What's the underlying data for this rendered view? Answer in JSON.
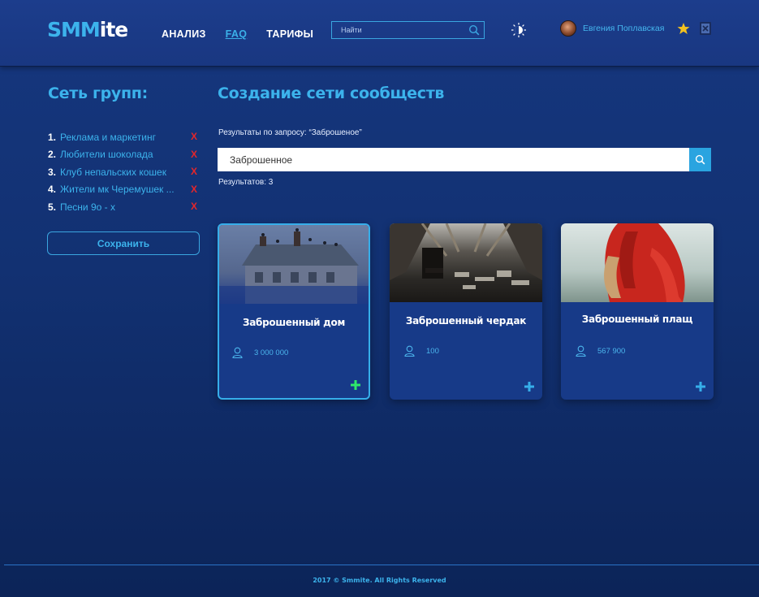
{
  "header": {
    "logo_main": "SMM",
    "logo_accent": "ite",
    "nav": [
      {
        "label": "АНАЛИЗ"
      },
      {
        "label": "FAQ",
        "active": true
      },
      {
        "label": "ТАРИФЫ"
      }
    ],
    "search_placeholder": "Найти",
    "user_name": "Евгения Поплавская"
  },
  "sidebar": {
    "title": "Сеть групп:",
    "groups": [
      {
        "num": "1.",
        "name": "Реклама и маркетинг"
      },
      {
        "num": "2.",
        "name": "Любители шоколада"
      },
      {
        "num": "3.",
        "name": "Клуб непальских кошек"
      },
      {
        "num": "4.",
        "name": "Жители мк Черемушек ..."
      },
      {
        "num": "5.",
        "name": "Песни 9о - х"
      }
    ],
    "remove_label": "X",
    "save_label": "Сохранить"
  },
  "main": {
    "title": "Создание сети сообществ",
    "query_label": "Результаты по запросу: “Заброшеное”",
    "search_value": "Заброшенное",
    "results_label": "Результатов: 3",
    "cards": [
      {
        "title": "Заброшенный дом",
        "members": "3 000 000",
        "selected": true,
        "image": "abandoned-house"
      },
      {
        "title": "Заброшенный чердак",
        "members": "100",
        "selected": false,
        "image": "abandoned-attic"
      },
      {
        "title": "Заброшенный плащ",
        "members": "567 900",
        "selected": false,
        "image": "red-cloak"
      }
    ]
  },
  "footer": {
    "copyright": "2017 © Smmite. All Rights Reserved"
  },
  "colors": {
    "accent": "#3cb3ec",
    "remove": "#e6262a",
    "add_selected": "#2ee86a",
    "add_default": "#36aeea"
  }
}
